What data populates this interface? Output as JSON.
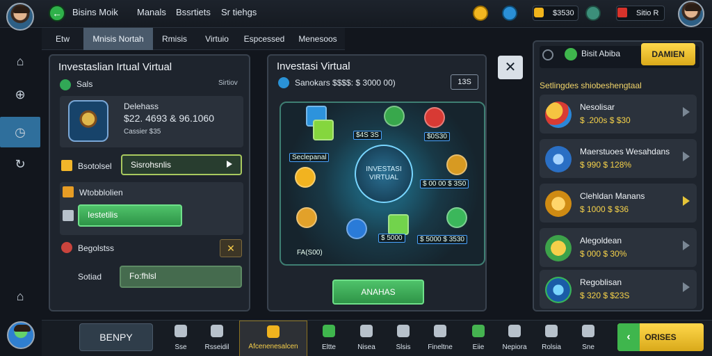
{
  "topbar": {
    "links": [
      "Bisins Moik",
      "Manals",
      "Bssrtiets",
      "Sr tiehgs"
    ],
    "currency1": "$3530",
    "currency2": "Sitio R"
  },
  "subtabs": [
    "Etw",
    "Mnisis Nortah",
    "Rmisis",
    "Virtuio",
    "Espcessed",
    "Menesoos"
  ],
  "left_panel": {
    "title": "Investaslian Irtual Virtual",
    "subtitle_left": "Sals",
    "subtitle_right": "Sirtiov",
    "card_label": "Delehass",
    "card_value": "$22. 4693 & 96.1060",
    "card_note": "Cassier $35",
    "row1_label": "Bsotolsel",
    "row1_button": "Sisrohsnlis",
    "row2_label": "Wtobblolien",
    "row2_button": "Iestetilis",
    "row3_label": "Begolstss",
    "row4_label": "Sotiad",
    "row4_value": "Fo:fhlsl"
  },
  "center_panel": {
    "title": "Investasi Virtual",
    "subtitle": "Sanokars $$$$: $ 3000 00)",
    "value_badge": "13S",
    "hub_line1": "INVESTASI",
    "hub_line2": "VIRTUAL",
    "labels": {
      "top_center": "$4S 3S",
      "top_right": "$0S30",
      "left_tag": "Seclepanal",
      "right_mid": "$ 00 00 $ 3S0",
      "bottom_center": "$ 5000",
      "bottom_right": "$ 5000 $ 3530",
      "bottom_left": "FA(S00)"
    },
    "primary_button": "ANAHAS"
  },
  "right_panel": {
    "header_label": "Bisit Abiba",
    "header_button": "DAMIEN",
    "section_title": "Setlingdes shiobeshengtaal",
    "items": [
      {
        "name": "Nesolisar",
        "price": "$ .200s $ $30"
      },
      {
        "name": "Maerstuoes Wesahdans",
        "price": "$ 990 $ 128%"
      },
      {
        "name": "Clehldan Manans",
        "price": "$ 1000 $ $36"
      },
      {
        "name": "Alegoldean",
        "price": "$ 000 $ 30%"
      },
      {
        "name": "Regoblisan",
        "price": "$ 320 $ $23S"
      }
    ]
  },
  "bottom": {
    "main_button": "BENPY",
    "items": [
      "Sse",
      "Rsseidil",
      "Afcenenesalcen",
      "Eltte",
      "Nisea",
      "Slsis",
      "Fineltne",
      "Eiie",
      "Nepiora",
      "Rolsia",
      "Sne"
    ],
    "right_button": "ORISES"
  }
}
